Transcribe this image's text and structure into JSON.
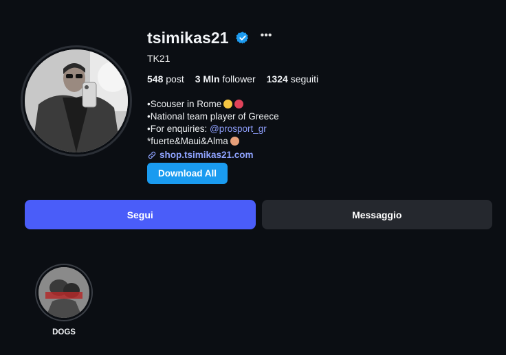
{
  "profile": {
    "username": "tsimikas21",
    "full_name": "TK21",
    "stats": {
      "posts_count": "548",
      "posts_label": "post",
      "followers_count": "3 Mln",
      "followers_label": "follower",
      "following_count": "1324",
      "following_label": "seguiti"
    },
    "bio": {
      "line1": "•Scouser in Rome",
      "line2": "•National team player of Greece",
      "line3_prefix": "•For enquiries: ",
      "line3_mention": "@prosport_gr",
      "line4": "*fuerte&Maui&Alma"
    },
    "link": "shop.tsimikas21.com",
    "download_label": "Download All"
  },
  "actions": {
    "follow_label": "Segui",
    "message_label": "Messaggio"
  },
  "highlights": [
    {
      "label": "DOGS"
    }
  ],
  "icons": {
    "verified": "verified-badge-icon",
    "more": "more-options-icon",
    "link": "link-icon"
  },
  "colors": {
    "background": "#0b0e13",
    "follow_button": "#4a5df9",
    "message_button": "#25282e",
    "download_button": "#1a9bf0",
    "mention": "#8c9cf8",
    "link": "#8fa3ff",
    "verified": "#1d9bf0"
  }
}
